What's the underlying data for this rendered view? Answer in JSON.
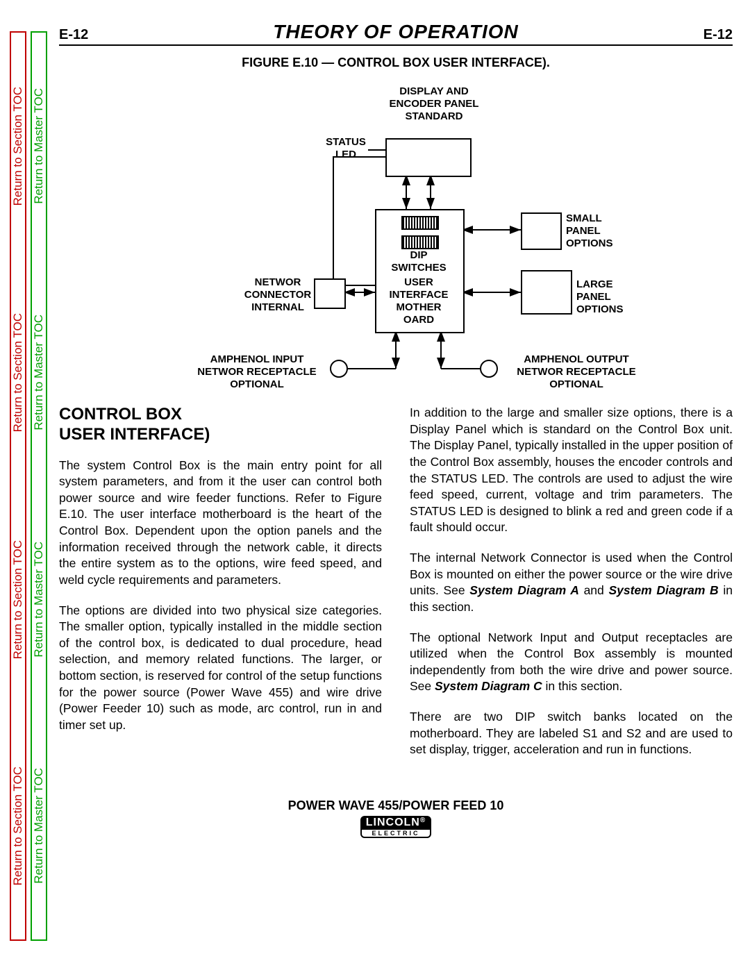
{
  "header": {
    "page_id": "E-12",
    "title": "THEORY OF OPERATION"
  },
  "side_nav": {
    "section_toc": "Return to Section TOC",
    "master_toc": "Return to Master TOC"
  },
  "figure": {
    "caption": "FIGURE E.10 — CONTROL BOX USER INTERFACE).",
    "labels": {
      "display_panel": "DISPLAY AND\nENCODER PANEL\nSTANDARD",
      "status_led": "STATUS\nLED",
      "dip_switches": "DIP\nSWITCHES",
      "network_connector": "NETWOR\nCONNECTOR\nINTERNAL",
      "user_interface_mb": "USER\nINTERFACE\nMOTHER\nOARD",
      "small_panel": "SMALL\nPANEL\nOPTIONS",
      "large_panel": "LARGE\nPANEL\nOPTIONS",
      "amphenol_input": "AMPHENOL INPUT\nNETWOR   RECEPTACLE\nOPTIONAL",
      "amphenol_output": "AMPHENOL OUTPUT\nNETWOR   RECEPTACLE\nOPTIONAL"
    }
  },
  "section_title": "CONTROL BOX\nUSER INTERFACE)",
  "paragraphs": {
    "left1": "The system Control Box is the main entry point for all system parameters, and from it the user can control both power source and wire feeder functions. Refer to Figure E.10. The user interface motherboard is the heart of the Control Box.  Dependent upon the option panels and the information received through the network cable, it directs the entire system as to the options, wire feed speed, and weld cycle requirements and parameters.",
    "left2": "The options are divided into two physical size categories.  The smaller option, typically installed in the middle section of the control box, is dedicated to dual procedure, head selection, and memory related functions.  The larger, or bottom section, is reserved for control of the setup functions for the power source (Power Wave 455) and wire drive (Power Feeder 10) such as mode, arc control, run in and timer set up.",
    "right1": "In addition to the large and smaller size options, there is a Display Panel which is standard on the Control Box unit.  The Display Panel, typically installed in the upper position of the Control Box assembly, houses the encoder controls and the STATUS LED.  The controls are used to adjust the wire feed speed, current, voltage and trim parameters.  The STATUS LED is designed to blink a red and green code if a fault should occur.",
    "right2a": "The internal Network Connector is used when the Control Box  is mounted on either the power source or the wire drive units. See ",
    "right2b": "System Diagram A",
    "right2c": " and ",
    "right2d": "System Diagram B",
    "right2e": " in this section.",
    "right3a": "The optional Network Input and Output receptacles are utilized when the Control Box assembly is mounted independently from both the wire drive and power source. See ",
    "right3b": "System Diagram C",
    "right3c": " in this section.",
    "right4": "There are two DIP switch banks located on the motherboard.  They are labeled S1 and S2 and are used to set display, trigger, acceleration and run in functions."
  },
  "footer": {
    "model": "POWER WAVE 455/POWER FEED 10",
    "logo1": "LINCOLN",
    "logo_r": "®",
    "logo2": "ELECTRIC"
  }
}
